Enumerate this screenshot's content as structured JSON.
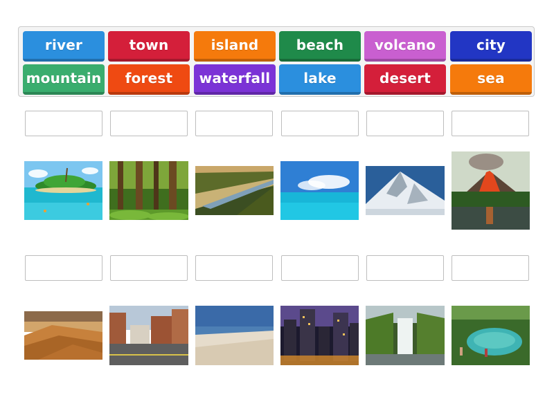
{
  "tiles": [
    {
      "label": "river",
      "color": "#2b8fde"
    },
    {
      "label": "town",
      "color": "#d41f3a"
    },
    {
      "label": "island",
      "color": "#f57a0c"
    },
    {
      "label": "beach",
      "color": "#1f8a4a"
    },
    {
      "label": "volcano",
      "color": "#c95fd0"
    },
    {
      "label": "city",
      "color": "#2236c4"
    },
    {
      "label": "mountain",
      "color": "#3aad6e"
    },
    {
      "label": "forest",
      "color": "#ef4a12"
    },
    {
      "label": "waterfall",
      "color": "#7b33d6"
    },
    {
      "label": "lake",
      "color": "#2b8fde"
    },
    {
      "label": "desert",
      "color": "#d41f3a"
    },
    {
      "label": "sea",
      "color": "#f57a0c"
    }
  ],
  "pictures_row1": [
    "island-photo",
    "forest-photo",
    "river-photo",
    "sea-photo",
    "mountain-photo",
    "volcano-photo"
  ],
  "pictures_row2": [
    "desert-photo",
    "town-photo",
    "beach-photo",
    "city-photo",
    "waterfall-photo",
    "lake-photo"
  ]
}
